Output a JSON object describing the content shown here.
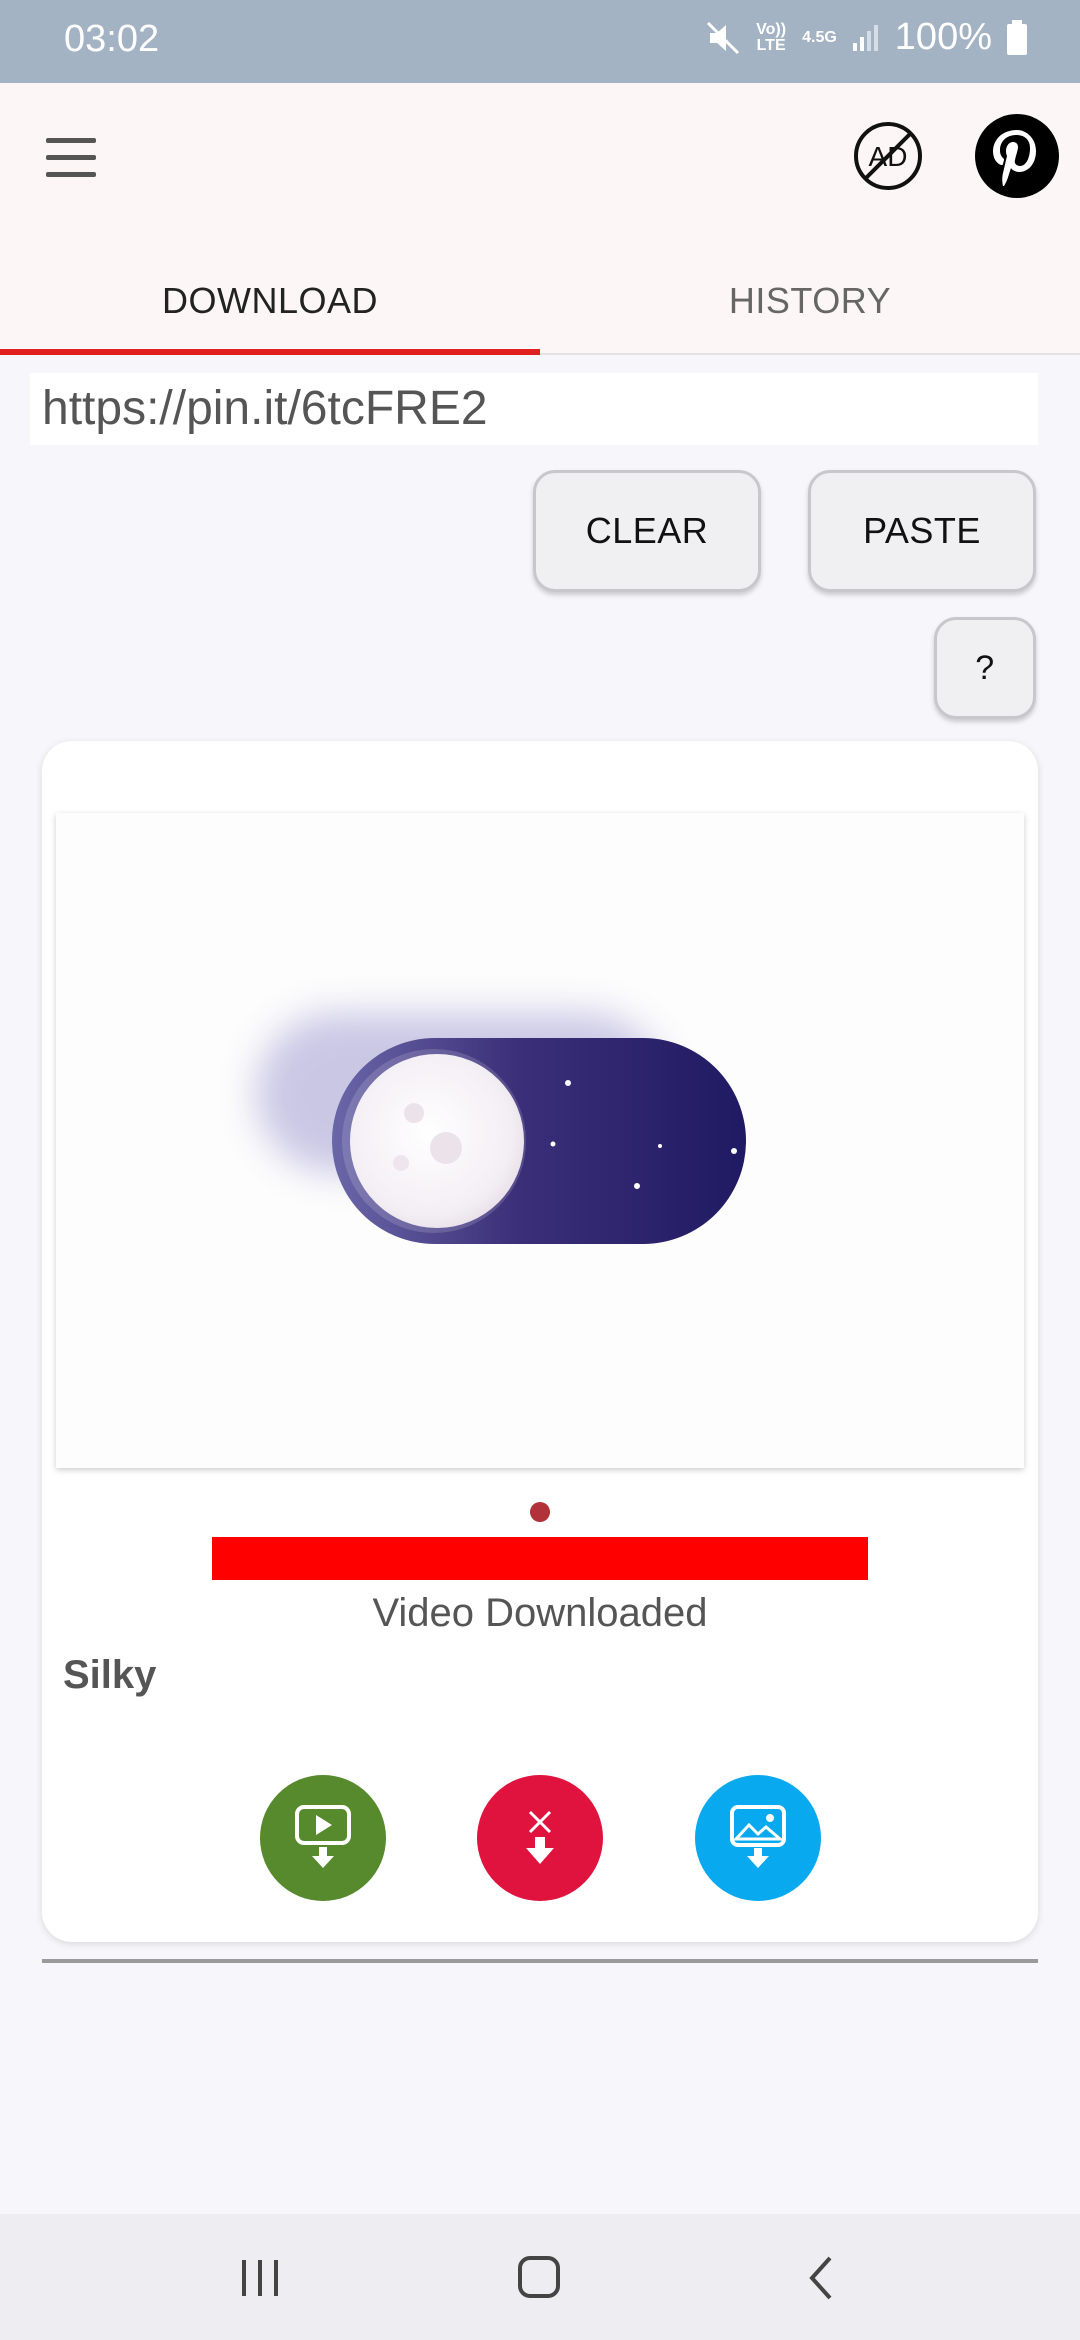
{
  "status_bar": {
    "time": "03:02",
    "volte": "Vo)) LTE",
    "network": "4.5G",
    "battery": "100%",
    "icons": [
      "mute-icon",
      "volte-icon",
      "signal-icon",
      "battery-icon"
    ]
  },
  "app_bar": {
    "menu_icon": "menu-icon",
    "no_ads_icon": "no-ads-icon",
    "no_ads_text": "AD",
    "pinterest_icon": "pinterest-logo-icon"
  },
  "tabs": [
    {
      "label": "DOWNLOAD",
      "active": true
    },
    {
      "label": "HISTORY",
      "active": false
    }
  ],
  "url_input": {
    "value": "https://pin.it/6tcFRE2"
  },
  "buttons": {
    "clear": "CLEAR",
    "paste": "PASTE",
    "help": "?"
  },
  "result": {
    "status": "Video Downloaded",
    "title": "Silky",
    "progress": 1.0,
    "actions": [
      {
        "icon": "download-video-icon",
        "color": "#568a2d"
      },
      {
        "icon": "download-no-watermark-icon",
        "color": "#e0123e"
      },
      {
        "icon": "download-image-icon",
        "color": "#08a9ef"
      }
    ]
  },
  "colors": {
    "accent": "#e01f1f",
    "progress": "#ff0000",
    "status_bar": "#a3b3c4"
  }
}
